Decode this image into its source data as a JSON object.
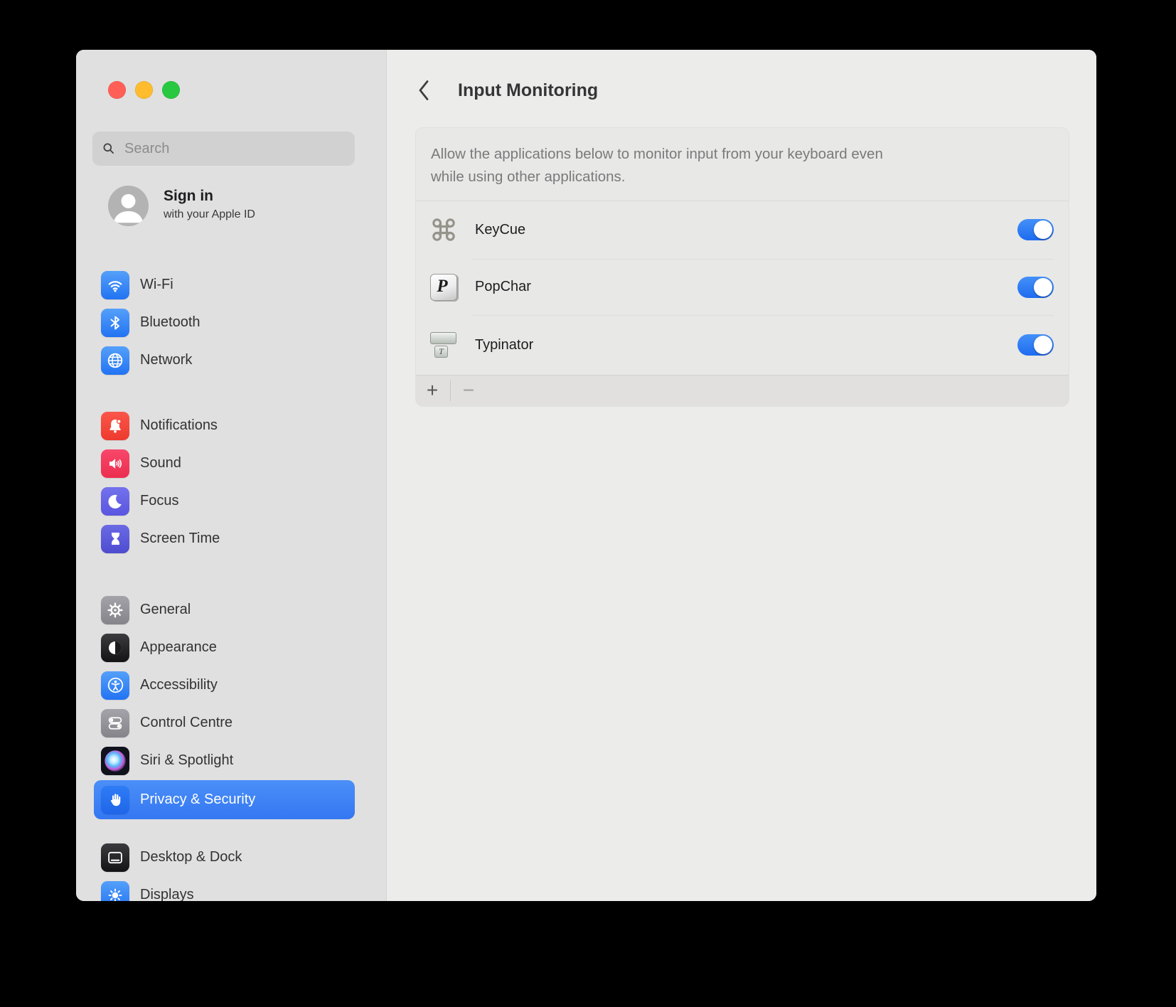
{
  "window": {
    "traffic_lights": [
      "close",
      "minimize",
      "zoom"
    ]
  },
  "sidebar": {
    "search": {
      "placeholder": "Search",
      "icon": "search-icon"
    },
    "signin": {
      "title": "Sign in",
      "subtitle": "with your Apple ID",
      "icon": "person-avatar"
    },
    "items": [
      {
        "label": "Wi-Fi",
        "icon": "wifi-icon",
        "selected": false
      },
      {
        "label": "Bluetooth",
        "icon": "bluetooth-icon",
        "selected": false
      },
      {
        "label": "Network",
        "icon": "globe-icon",
        "selected": false
      },
      {
        "label": "Notifications",
        "icon": "bell-icon",
        "selected": false
      },
      {
        "label": "Sound",
        "icon": "speaker-icon",
        "selected": false
      },
      {
        "label": "Focus",
        "icon": "moon-icon",
        "selected": false
      },
      {
        "label": "Screen Time",
        "icon": "hourglass-icon",
        "selected": false
      },
      {
        "label": "General",
        "icon": "gear-icon",
        "selected": false
      },
      {
        "label": "Appearance",
        "icon": "contrast-icon",
        "selected": false
      },
      {
        "label": "Accessibility",
        "icon": "accessibility-icon",
        "selected": false
      },
      {
        "label": "Control Centre",
        "icon": "toggles-icon",
        "selected": false
      },
      {
        "label": "Siri & Spotlight",
        "icon": "siri-orb-icon",
        "selected": false
      },
      {
        "label": "Privacy & Security",
        "icon": "hand-icon",
        "selected": true
      },
      {
        "label": "Desktop & Dock",
        "icon": "window-dock-icon",
        "selected": false
      },
      {
        "label": "Displays",
        "icon": "brightness-icon",
        "selected": false
      }
    ]
  },
  "main": {
    "back_icon": "chevron-left-icon",
    "title": "Input Monitoring",
    "description_line1": "Allow the applications below to monitor input from your keyboard even",
    "description_line2": "while using other applications.",
    "apps": [
      {
        "name": "KeyCue",
        "icon": "command-knot-icon",
        "enabled": true
      },
      {
        "name": "PopChar",
        "icon": "p-key-icon",
        "enabled": true
      },
      {
        "name": "Typinator",
        "icon": "typewriter-key-icon",
        "enabled": true
      }
    ],
    "footer": {
      "add": "+",
      "remove": "−"
    }
  },
  "colors": {
    "accent_blue": "#3478f6",
    "toggle_on": "#2a7af2",
    "selected_row": "#3d80f7",
    "traffic_red": "#ff5f57",
    "traffic_yellow": "#febc2e",
    "traffic_green": "#28c840",
    "window_sidebar_bg": "#e1e0e0",
    "window_main_bg": "#ececeb"
  }
}
